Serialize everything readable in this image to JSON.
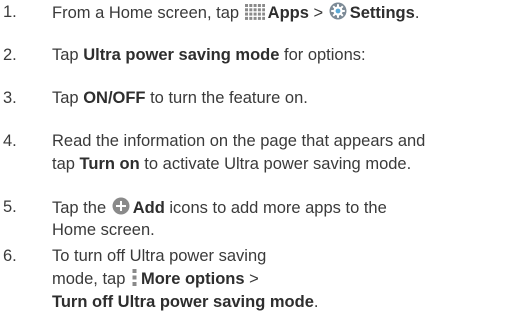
{
  "steps": [
    {
      "number": "1.",
      "parts": {
        "a": "From a Home screen, tap ",
        "apps": "Apps",
        "sep": " > ",
        "settings": "Settings",
        "end": "."
      },
      "icons": [
        "apps-grid-icon",
        "settings-gear-icon"
      ]
    },
    {
      "number": "2.",
      "parts": {
        "a": "Tap ",
        "b": "Ultra power saving mode",
        "c": " for options:"
      }
    },
    {
      "number": "3.",
      "parts": {
        "a": "Tap ",
        "b": "ON/OFF",
        "c": " to turn the feature on."
      }
    },
    {
      "number": "4.",
      "parts": {
        "line1": "Read the information on the page that appears and",
        "a": "tap ",
        "b": "Turn on",
        "c": " to activate Ultra power saving mode."
      }
    },
    {
      "number": "5.",
      "parts": {
        "a": "Tap the ",
        "b": "Add",
        "c": " icons to add more apps to the",
        "line2": "Home screen."
      },
      "icons": [
        "add-circle-icon"
      ]
    },
    {
      "number": "6.",
      "parts": {
        "line1": "To turn off Ultra power saving",
        "a": "mode, tap ",
        "b": "More options",
        "c": " >",
        "line3": "Turn off Ultra power saving mode",
        "end": "."
      },
      "icons": [
        "more-options-icon"
      ]
    }
  ],
  "colors": {
    "text": "#3a3a3a",
    "icon": "#8a8a8a"
  }
}
